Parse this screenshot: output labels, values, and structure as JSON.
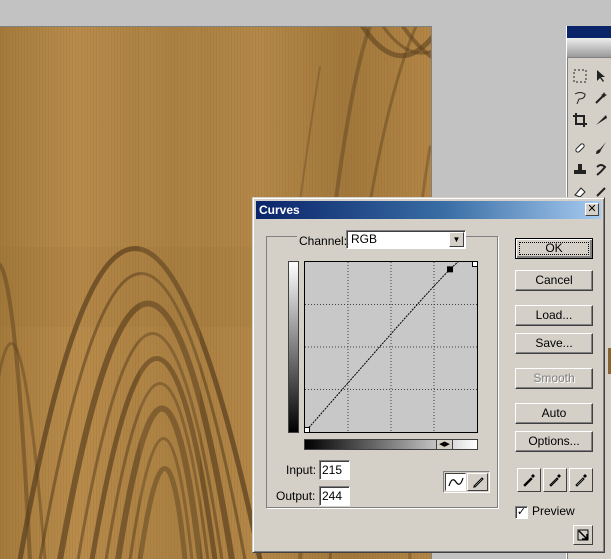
{
  "dialog": {
    "title": "Curves",
    "close_glyph": "✕",
    "channel_label": "Channel:",
    "channel_value": "RGB",
    "input_label": "Input:",
    "input_value": "215",
    "output_label": "Output:",
    "output_value": "244",
    "buttons": {
      "ok": "OK",
      "cancel": "Cancel",
      "load": "Load...",
      "save": "Save...",
      "smooth": "Smooth",
      "auto": "Auto",
      "options": "Options..."
    },
    "preview_label": "Preview",
    "preview_checked": true
  },
  "curve": {
    "points": [
      [
        0,
        0
      ],
      [
        215,
        244
      ],
      [
        255,
        255
      ]
    ],
    "selected_point": [
      215,
      244
    ],
    "grid_divisions": 4
  },
  "icons": {
    "curve_mode": "curve-icon",
    "pencil_mode": "pencil-icon",
    "eyedroppers": [
      "black-eyedropper-icon",
      "gray-eyedropper-icon",
      "white-eyedropper-icon"
    ],
    "resize": "resize-icon"
  },
  "colors": {
    "wood_base": "#a77d3f",
    "wood_grain": "#5e4220",
    "titlebar_start": "#0a246a",
    "titlebar_end": "#a6caf0"
  }
}
